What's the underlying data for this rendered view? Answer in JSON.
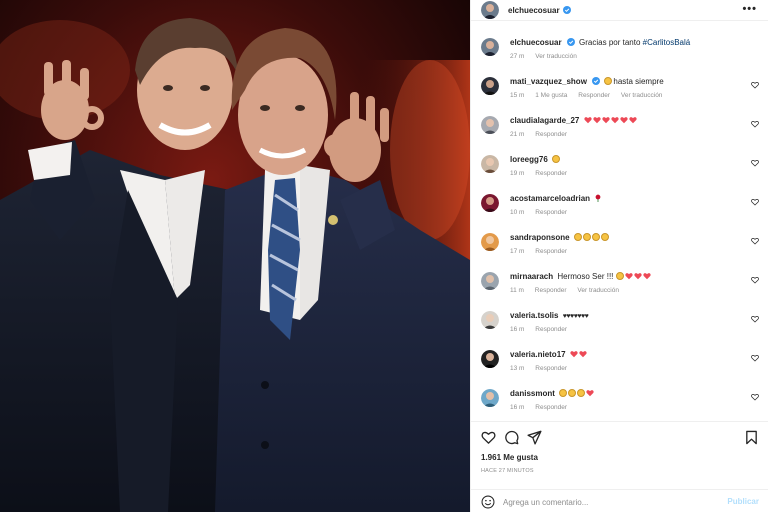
{
  "post": {
    "author": "elchuecosuar",
    "more_icon": "more-horizontal-icon",
    "caption_text": "Gracias por tanto",
    "caption_tag": "#CarlitosBalá",
    "caption_time": "27 m",
    "caption_translate": "Ver traducción"
  },
  "comments": [
    {
      "user": "mati_vazquez_show",
      "verified": true,
      "text": "hasta siempre",
      "time": "15 m",
      "likes": "1 Me gusta",
      "reply": "Responder",
      "translate": "Ver traducción"
    },
    {
      "user": "claudialagarde_27",
      "verified": false,
      "text": "",
      "time": "21 m",
      "reply": "Responder"
    },
    {
      "user": "loreegg76",
      "verified": false,
      "text": "",
      "time": "19 m",
      "reply": "Responder"
    },
    {
      "user": "acostamarceloadrian",
      "verified": false,
      "text": "",
      "time": "10 m",
      "reply": "Responder"
    },
    {
      "user": "sandraponsone",
      "verified": false,
      "text": "",
      "time": "17 m",
      "reply": "Responder"
    },
    {
      "user": "mirnaarach",
      "verified": false,
      "text": "Hermoso Ser !!!",
      "time": "11 m",
      "reply": "Responder",
      "translate": "Ver traducción"
    },
    {
      "user": "valeria.tsolis",
      "verified": false,
      "text": "♥♥♥♥♥♥♥",
      "time": "16 m",
      "reply": "Responder"
    },
    {
      "user": "valeria.nieto17",
      "verified": false,
      "text": "",
      "time": "13 m",
      "reply": "Responder"
    },
    {
      "user": "danissmont",
      "verified": false,
      "text": "",
      "time": "16 m",
      "reply": "Responder"
    }
  ],
  "actions": {
    "likes": "1.961 Me gusta",
    "ago": "HACE 27 MINUTOS",
    "comment_placeholder": "Agrega un comentario...",
    "publish_label": "Publicar"
  },
  "colors": {
    "verified": "#3897f0",
    "heart": "#ed4956",
    "link": "#00376b",
    "muted": "#8e8e8e",
    "publish": "#b2dffc"
  }
}
